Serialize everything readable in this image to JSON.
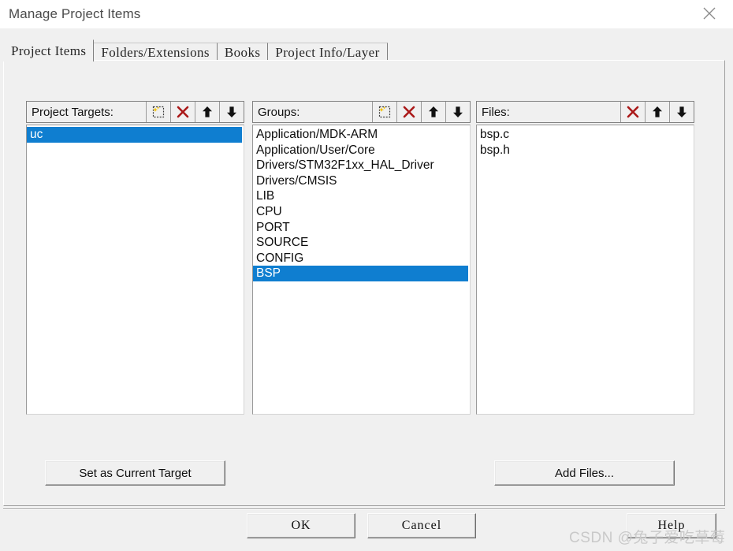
{
  "window": {
    "title": "Manage Project Items",
    "close_icon": "close-icon"
  },
  "tabs": [
    {
      "label": "Project Items",
      "active": true
    },
    {
      "label": "Folders/Extensions",
      "active": false
    },
    {
      "label": "Books",
      "active": false
    },
    {
      "label": "Project Info/Layer",
      "active": false
    }
  ],
  "columns": {
    "targets": {
      "label": "Project Targets:",
      "buttons": [
        "new-item-icon",
        "delete-icon",
        "move-up-icon",
        "move-down-icon"
      ],
      "items": [
        {
          "label": "uc",
          "selected": true
        }
      ]
    },
    "groups": {
      "label": "Groups:",
      "buttons": [
        "new-item-icon",
        "delete-icon",
        "move-up-icon",
        "move-down-icon"
      ],
      "items": [
        {
          "label": "Application/MDK-ARM",
          "selected": false
        },
        {
          "label": "Application/User/Core",
          "selected": false
        },
        {
          "label": "Drivers/STM32F1xx_HAL_Driver",
          "selected": false
        },
        {
          "label": "Drivers/CMSIS",
          "selected": false
        },
        {
          "label": "LIB",
          "selected": false
        },
        {
          "label": "CPU",
          "selected": false
        },
        {
          "label": "PORT",
          "selected": false
        },
        {
          "label": "SOURCE",
          "selected": false
        },
        {
          "label": "CONFIG",
          "selected": false
        },
        {
          "label": "BSP",
          "selected": true
        }
      ]
    },
    "files": {
      "label": "Files:",
      "buttons": [
        "delete-icon",
        "move-up-icon",
        "move-down-icon"
      ],
      "items": [
        {
          "label": "bsp.c",
          "selected": false
        },
        {
          "label": "bsp.h",
          "selected": false
        }
      ]
    }
  },
  "actions": {
    "set_as_current_target": "Set as Current Target",
    "add_files": "Add Files..."
  },
  "footer": {
    "ok": "OK",
    "cancel": "Cancel",
    "help": "Help"
  },
  "watermark": "CSDN @兔子爱吃草莓",
  "colors": {
    "selection_blue": "#0f7ed0",
    "dialog_face": "#f0f0f0",
    "delete_red": "#aa1818",
    "title_text": "#4b4b4b"
  }
}
